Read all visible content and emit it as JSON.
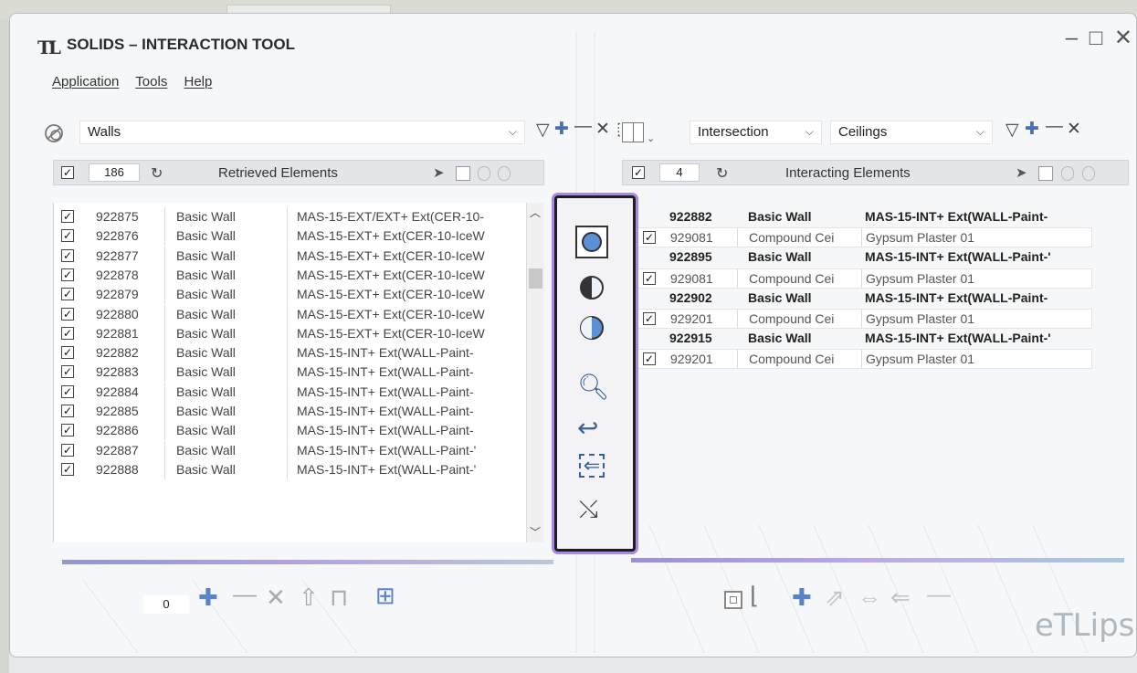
{
  "window": {
    "logo": "TL",
    "title": "SOLIDS – INTERACTION TOOL",
    "minimize": "–",
    "maximize": "□",
    "close": "✕"
  },
  "menu": [
    "Application",
    "Tools",
    "Help"
  ],
  "left": {
    "category": "Walls",
    "count": "186",
    "header_label": "Retrieved Elements",
    "rows": [
      {
        "id": "922875",
        "family": "Basic Wall",
        "type": "MAS-15-EXT/EXT+ Ext(CER-10-"
      },
      {
        "id": "922876",
        "family": "Basic Wall",
        "type": "MAS-15-EXT+ Ext(CER-10-IceW"
      },
      {
        "id": "922877",
        "family": "Basic Wall",
        "type": "MAS-15-EXT+ Ext(CER-10-IceW"
      },
      {
        "id": "922878",
        "family": "Basic Wall",
        "type": "MAS-15-EXT+ Ext(CER-10-IceW"
      },
      {
        "id": "922879",
        "family": "Basic Wall",
        "type": "MAS-15-EXT+ Ext(CER-10-IceW"
      },
      {
        "id": "922880",
        "family": "Basic Wall",
        "type": "MAS-15-EXT+ Ext(CER-10-IceW"
      },
      {
        "id": "922881",
        "family": "Basic Wall",
        "type": "MAS-15-EXT+ Ext(CER-10-IceW"
      },
      {
        "id": "922882",
        "family": "Basic Wall",
        "type": "MAS-15-INT+ Ext(WALL-Paint-"
      },
      {
        "id": "922883",
        "family": "Basic Wall",
        "type": "MAS-15-INT+ Ext(WALL-Paint-"
      },
      {
        "id": "922884",
        "family": "Basic Wall",
        "type": "MAS-15-INT+ Ext(WALL-Paint-"
      },
      {
        "id": "922885",
        "family": "Basic Wall",
        "type": "MAS-15-INT+ Ext(WALL-Paint-"
      },
      {
        "id": "922886",
        "family": "Basic Wall",
        "type": "MAS-15-INT+ Ext(WALL-Paint-"
      },
      {
        "id": "922887",
        "family": "Basic Wall",
        "type": "MAS-15-INT+ Ext(WALL-Paint-'"
      },
      {
        "id": "922888",
        "family": "Basic Wall",
        "type": "MAS-15-INT+ Ext(WALL-Paint-'"
      }
    ]
  },
  "right": {
    "mode": "Intersection",
    "category": "Ceilings",
    "count": "4",
    "header_label": "Interacting Elements",
    "rows": [
      {
        "kind": "parent",
        "id": "922882",
        "family": "Basic Wall",
        "type": "MAS-15-INT+ Ext(WALL-Paint-"
      },
      {
        "kind": "child",
        "id": "929081",
        "family": "Compound Cei",
        "type": "Gypsum Plaster 01"
      },
      {
        "kind": "parent",
        "id": "922895",
        "family": "Basic Wall",
        "type": "MAS-15-INT+ Ext(WALL-Paint-'"
      },
      {
        "kind": "child",
        "id": "929081",
        "family": "Compound Cei",
        "type": "Gypsum Plaster 01"
      },
      {
        "kind": "parent",
        "id": "922902",
        "family": "Basic Wall",
        "type": "MAS-15-INT+ Ext(WALL-Paint-"
      },
      {
        "kind": "child",
        "id": "929201",
        "family": "Compound Cei",
        "type": "Gypsum Plaster 01"
      },
      {
        "kind": "parent",
        "id": "922915",
        "family": "Basic Wall",
        "type": "MAS-15-INT+ Ext(WALL-Paint-'"
      },
      {
        "kind": "child",
        "id": "929201",
        "family": "Compound Cei",
        "type": "Gypsum Plaster 01"
      }
    ]
  },
  "bottom": {
    "count": "0",
    "brand": "eTLipse"
  },
  "colors": {
    "highlight": "#a78ae6",
    "accent_blue": "#5b8fd6"
  }
}
